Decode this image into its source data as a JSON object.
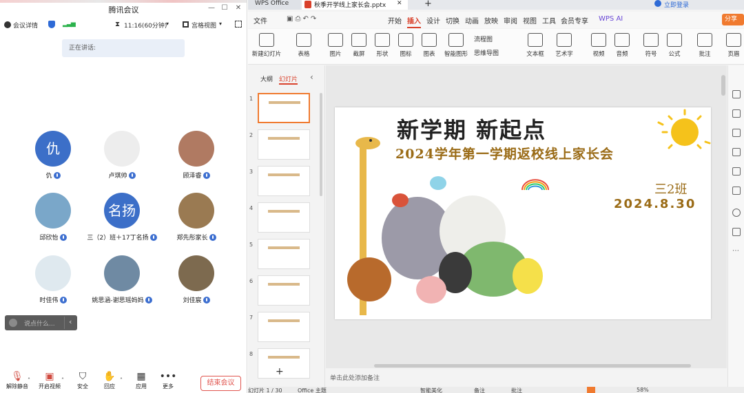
{
  "meeting": {
    "title": "腾讯会议",
    "info": {
      "details": "会议详情",
      "timer": "11:16(60分钟)",
      "view": "宫格视图"
    },
    "speaking": "正在讲话:",
    "participants": [
      {
        "name": "仇",
        "avatar_text": "仇",
        "avatar_color": "#3c6fc8"
      },
      {
        "name": "卢琪帅",
        "avatar_text": "",
        "avatar_color": "#ededed"
      },
      {
        "name": "顾泽睿",
        "avatar_text": "",
        "avatar_color": "#b07a62"
      },
      {
        "name": "邱欣怡",
        "avatar_text": "",
        "avatar_color": "#7aa7c9"
      },
      {
        "name": "三（2）班＋17丁名扬",
        "avatar_text": "名扬",
        "avatar_color": "#3c6fc8"
      },
      {
        "name": "郑先彤家长",
        "avatar_text": "",
        "avatar_color": "#9a7a52"
      },
      {
        "name": "时佳伟",
        "avatar_text": "",
        "avatar_color": "#dfe9ef"
      },
      {
        "name": "姚思涵-谢思瑶妈妈",
        "avatar_text": "",
        "avatar_color": "#6f8aa3"
      },
      {
        "name": "刘佳宸",
        "avatar_text": "",
        "avatar_color": "#7d6a4f"
      }
    ],
    "chat_placeholder": "说点什么...",
    "toolbar": {
      "mute": "解除静音",
      "video": "开启视频",
      "security": "安全",
      "reaction": "回应",
      "apps": "应用",
      "more": "更多",
      "leave": "结束会议"
    }
  },
  "wps": {
    "tabs": {
      "home": "WPS Office",
      "doc": "秋季开学线上家长会.pptx"
    },
    "login": "立即登录",
    "menu": {
      "file": "文件",
      "start": "开始",
      "insert": "插入",
      "design": "设计",
      "switch": "切换",
      "animation": "动画",
      "slideshow": "放映",
      "review": "审阅",
      "view": "视图",
      "tools": "工具",
      "member": "会员专享",
      "ai": "WPS AI",
      "share": "分享"
    },
    "ribbon": {
      "new_slide": "新建幻灯片",
      "table": "表格",
      "picture": "图片",
      "screenshot": "截屏",
      "shape": "形状",
      "icon": "图标",
      "chart": "图表",
      "smart": "智能图形",
      "flowchart": "流程图",
      "mindmap": "思维导图",
      "textbox": "文本框",
      "wordart": "艺术字",
      "video": "视频",
      "audio": "音频",
      "symbol": "符号",
      "formula": "公式",
      "comment": "批注",
      "header": "页眉"
    },
    "panel_tabs": {
      "outline": "大纲",
      "slides": "幻灯片"
    },
    "thumb_numbers": [
      "1",
      "2",
      "3",
      "4",
      "5",
      "6",
      "7",
      "8"
    ],
    "slide": {
      "title": "新学期  新起点",
      "subtitle": "2024学年第一学期返校线上家长会",
      "class": "三2班",
      "date": "2024.8.30"
    },
    "notes_placeholder": "单击此处添加备注",
    "status": {
      "slide_count": "幻灯片 1 / 30",
      "theme": "Office 主题",
      "beautify": "智能美化",
      "notes": "备注",
      "comment": "批注",
      "zoom": "58%"
    }
  }
}
